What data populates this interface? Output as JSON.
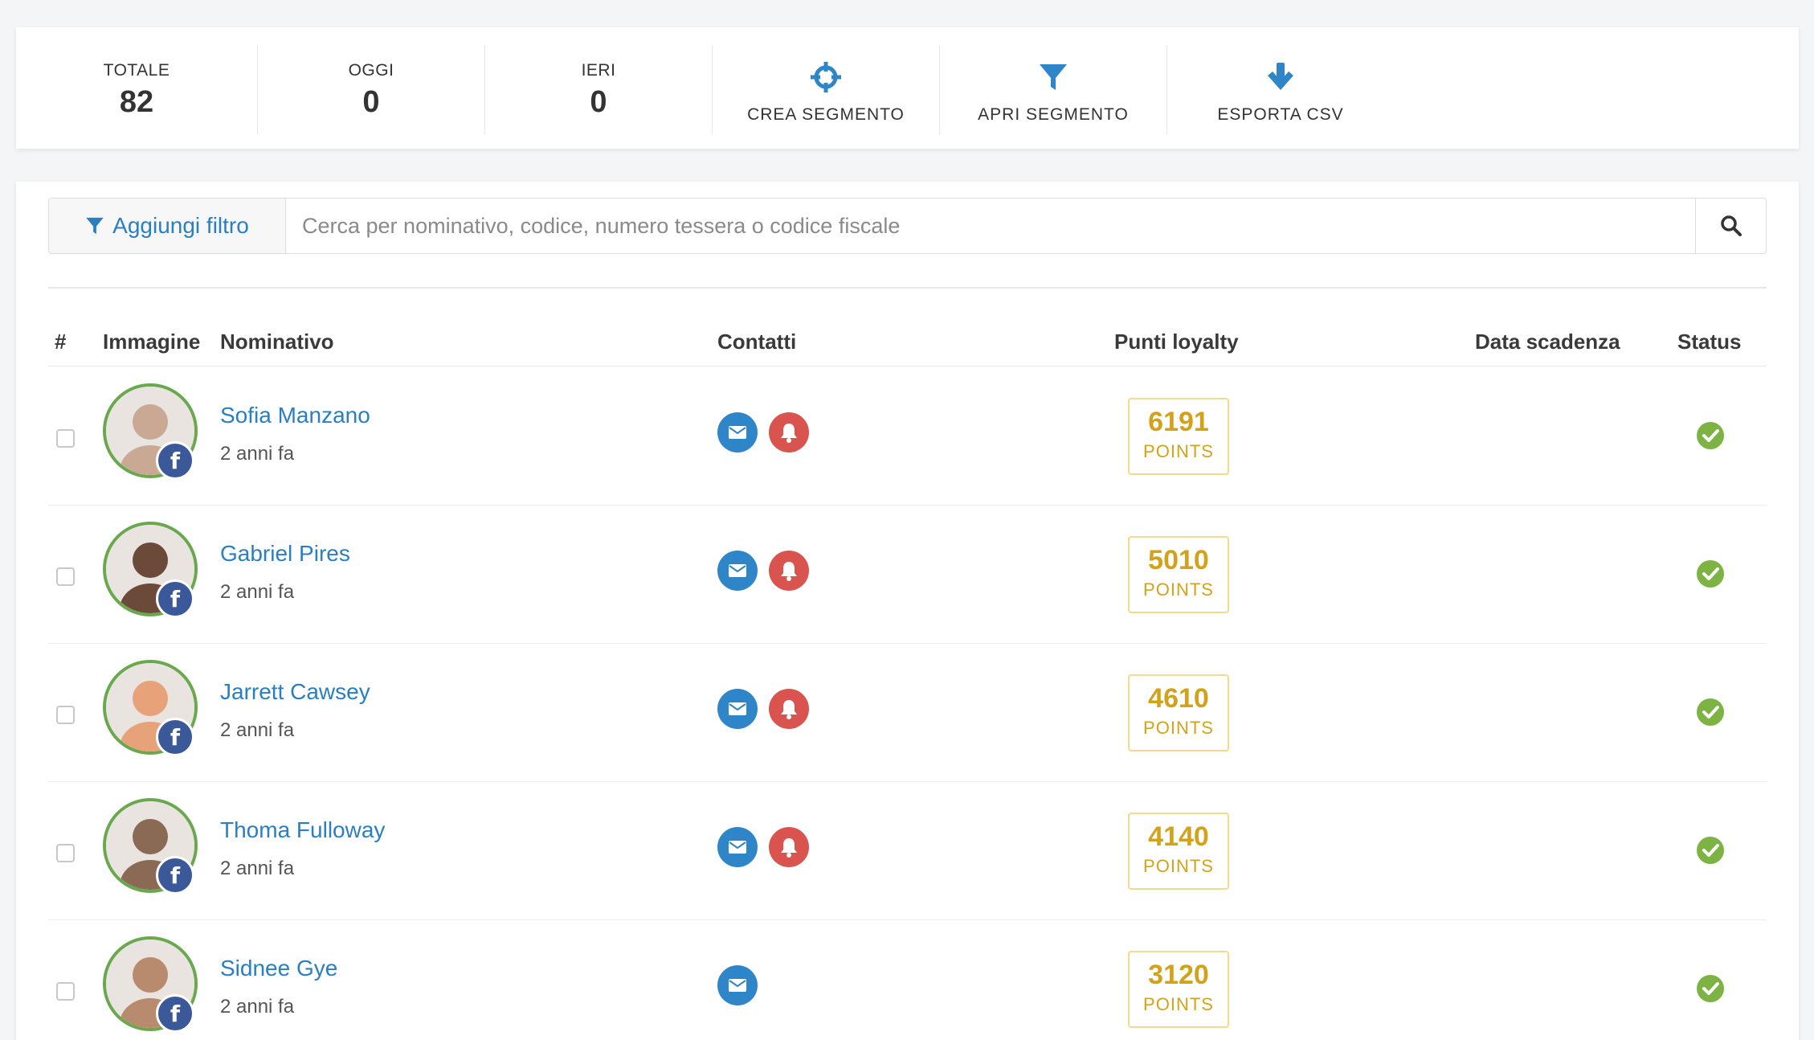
{
  "stats": [
    {
      "label": "TOTALE",
      "value": "82"
    },
    {
      "label": "OGGI",
      "value": "0"
    },
    {
      "label": "IERI",
      "value": "0"
    }
  ],
  "actions": [
    {
      "label": "CREA SEGMENTO",
      "icon": "crosshair-icon"
    },
    {
      "label": "APRI SEGMENTO",
      "icon": "filter-icon"
    },
    {
      "label": "ESPORTA CSV",
      "icon": "arrow-down-icon"
    }
  ],
  "filter": {
    "button_label": "Aggiungi filtro",
    "search_placeholder": "Cerca per nominativo, codice, numero tessera o codice fiscale",
    "search_value": ""
  },
  "table": {
    "headers": {
      "index": "#",
      "image": "Immagine",
      "name": "Nominativo",
      "contacts": "Contatti",
      "points": "Punti loyalty",
      "expiry": "Data scadenza",
      "status": "Status"
    },
    "rows": [
      {
        "name": "Sofia Manzano",
        "time": "2 anni fa",
        "points": "6191",
        "points_label": "POINTS",
        "has_bell": true,
        "avatar_color": "#c9a894"
      },
      {
        "name": "Gabriel Pires",
        "time": "2 anni fa",
        "points": "5010",
        "points_label": "POINTS",
        "has_bell": true,
        "avatar_color": "#6b4a3a"
      },
      {
        "name": "Jarrett Cawsey",
        "time": "2 anni fa",
        "points": "4610",
        "points_label": "POINTS",
        "has_bell": true,
        "avatar_color": "#e8a27a"
      },
      {
        "name": "Thoma Fulloway",
        "time": "2 anni fa",
        "points": "4140",
        "points_label": "POINTS",
        "has_bell": true,
        "avatar_color": "#8a6a55"
      },
      {
        "name": "Sidnee Gye",
        "time": "2 anni fa",
        "points": "3120",
        "points_label": "POINTS",
        "has_bell": false,
        "avatar_color": "#b88a6e"
      }
    ]
  },
  "colors": {
    "accent": "#2a7fc1",
    "mail": "#2e86c9",
    "bell": "#d9534f",
    "points": "#d4a21a",
    "status_ok": "#7cb342",
    "facebook": "#3b5998"
  }
}
